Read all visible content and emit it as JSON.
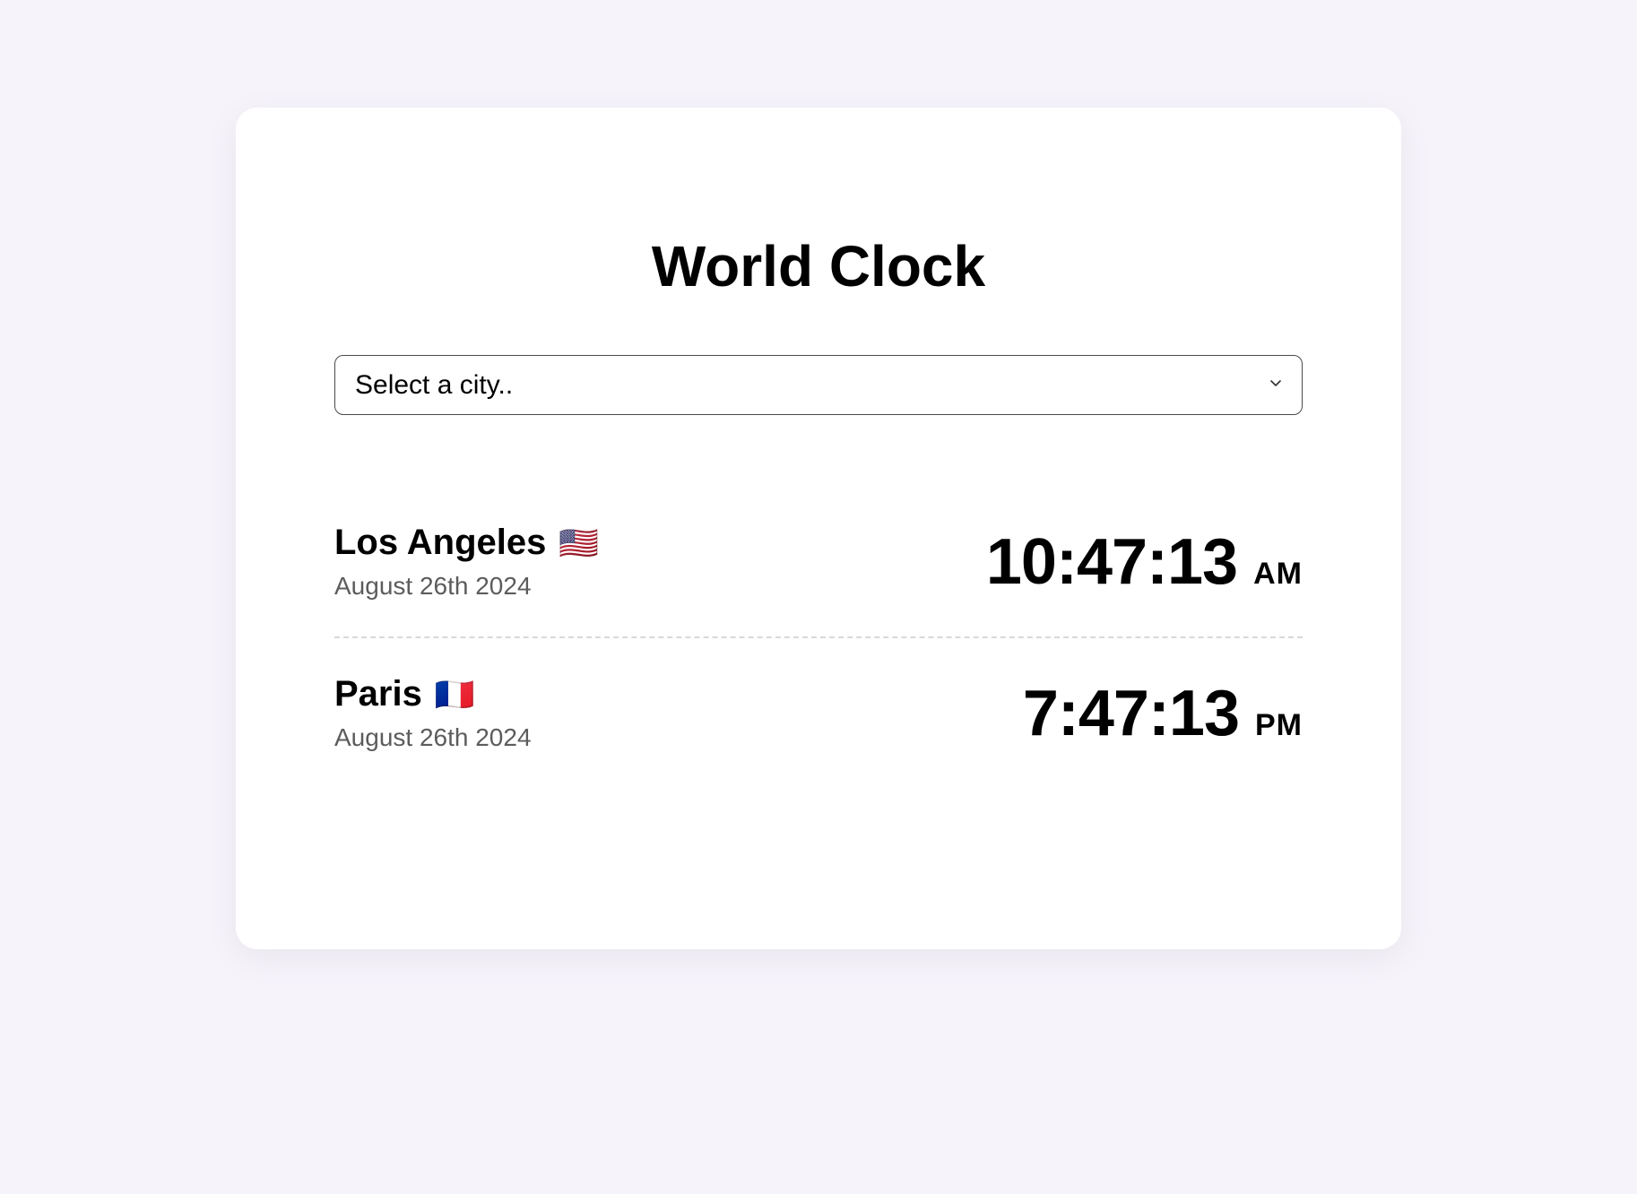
{
  "title": "World Clock",
  "select": {
    "placeholder": "Select a city.."
  },
  "cities": [
    {
      "name": "Los Angeles",
      "flag": "🇺🇸",
      "date": "August 26th 2024",
      "time": "10:47:13",
      "ampm": "AM"
    },
    {
      "name": "Paris",
      "flag": "🇫🇷",
      "date": "August 26th 2024",
      "time": "7:47:13",
      "ampm": "PM"
    }
  ]
}
